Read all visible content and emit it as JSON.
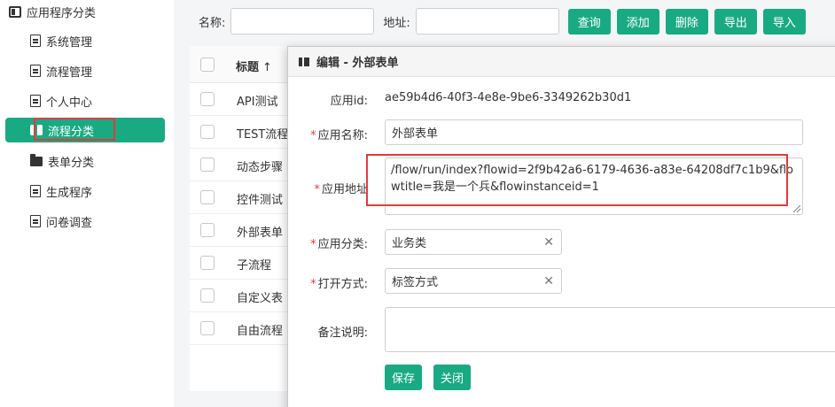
{
  "sidebar": {
    "root": {
      "label": "应用程序分类",
      "icon": "app-category-icon"
    },
    "items": [
      {
        "label": "系统管理",
        "icon": "document-icon"
      },
      {
        "label": "流程管理",
        "icon": "document-icon"
      },
      {
        "label": "个人中心",
        "icon": "document-icon"
      },
      {
        "label": "流程分类",
        "icon": "open-folder-icon",
        "active": true
      },
      {
        "label": "表单分类",
        "icon": "folder-icon"
      },
      {
        "label": "生成程序",
        "icon": "document-icon"
      },
      {
        "label": "问卷调查",
        "icon": "document-icon"
      }
    ]
  },
  "toolbar": {
    "name_label": "名称:",
    "name_value": "",
    "address_label": "地址:",
    "address_value": "",
    "query_label": "查询",
    "add_label": "添加",
    "delete_label": "删除",
    "export_label": "导出",
    "import_label": "导入"
  },
  "table": {
    "title_header": "标题",
    "sort_glyph": "↑",
    "rows": [
      "API测试",
      "TEST流程",
      "动态步骤",
      "控件测试",
      "外部表单",
      "子流程",
      "自定义表",
      "自由流程"
    ]
  },
  "dialog": {
    "title": "编辑 - 外部表单",
    "app_id_label": "应用id:",
    "app_id_value": "ae59b4d6-40f3-4e8e-9be6-3349262b30d1",
    "app_name_label": "应用名称:",
    "app_name_value": "外部表单",
    "app_address_label": "应用地址",
    "app_address_value": "/flow/run/index?flowid=2f9b42a6-6179-4636-a83e-64208df7c1b9&flowtitle=我是一个兵&flowinstanceid=1",
    "app_category_label": "应用分类:",
    "app_category_value": "业务类",
    "open_mode_label": "打开方式:",
    "open_mode_value": "标签方式",
    "remarks_label": "备注说明:",
    "remarks_value": "",
    "required_mark": "*",
    "clear_glyph": "✕",
    "save_label": "保存",
    "close_label": "关闭"
  },
  "colors": {
    "accent": "#1aaa83",
    "highlight": "#e23b3b"
  }
}
